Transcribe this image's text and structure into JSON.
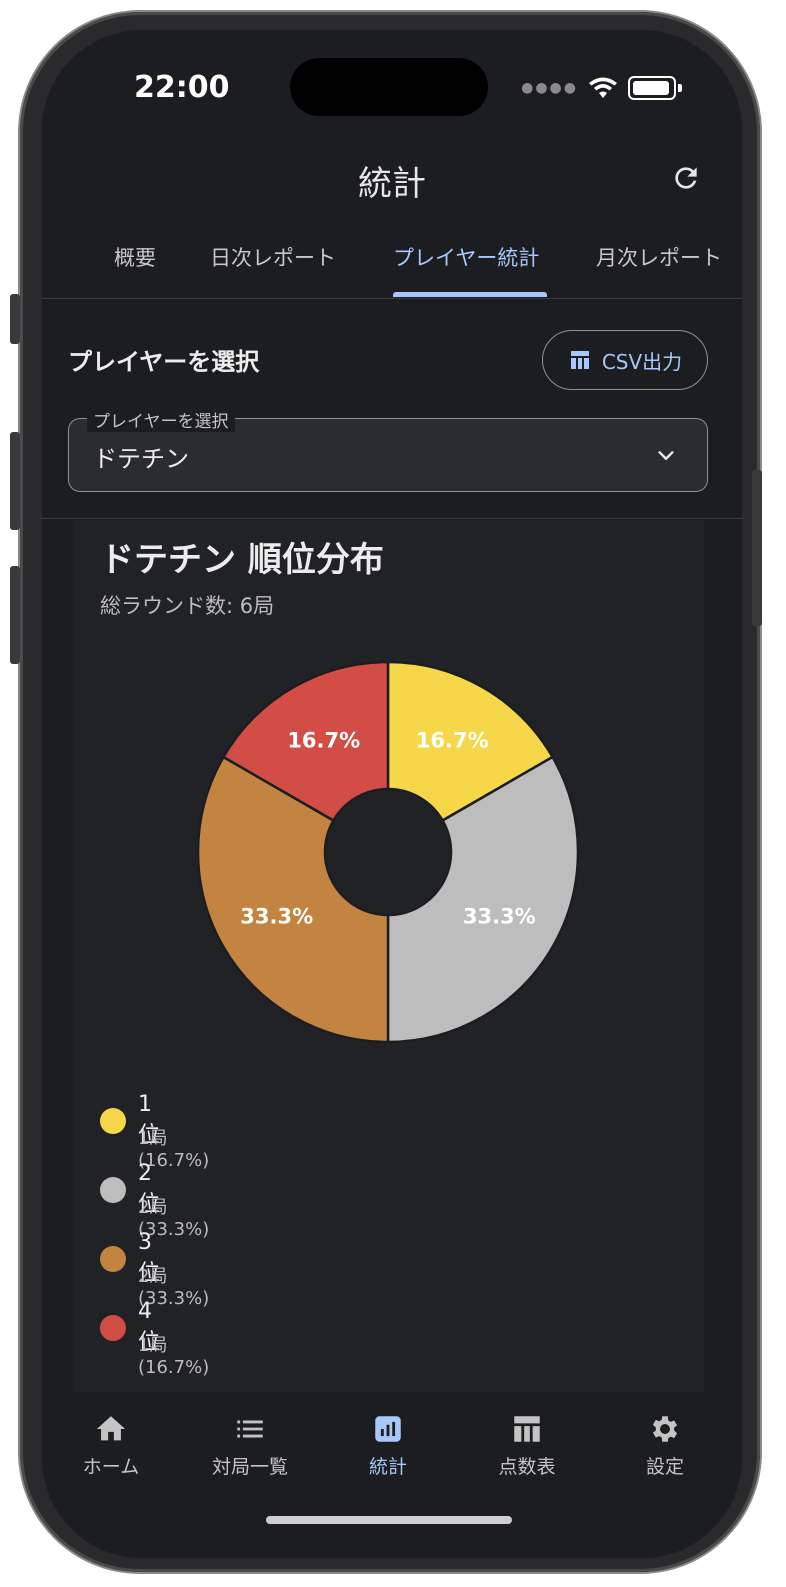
{
  "status_bar": {
    "time": "22:00"
  },
  "header": {
    "title": "統計",
    "refresh_icon": "refresh-icon"
  },
  "tabs": [
    {
      "label": "概要",
      "active": false
    },
    {
      "label": "日次レポート",
      "active": false
    },
    {
      "label": "プレイヤー統計",
      "active": true
    },
    {
      "label": "月次レポート",
      "active": false
    }
  ],
  "player_section": {
    "label": "プレイヤーを選択",
    "csv_button": "CSV出力",
    "select": {
      "legend": "プレイヤーを選択",
      "value": "ドテチン"
    }
  },
  "card": {
    "title": "ドテチン 順位分布",
    "subtitle": "総ラウンド数: 6局"
  },
  "chart_data": {
    "type": "pie",
    "donut": true,
    "categories": [
      "1位",
      "2位",
      "3位",
      "4位"
    ],
    "values": [
      1,
      2,
      2,
      1
    ],
    "percent_labels": [
      "16.7%",
      "33.3%",
      "33.3%",
      "16.7%"
    ],
    "colors": [
      "#f6d74a",
      "#bdbdbd",
      "#c28440",
      "#d24d45"
    ],
    "legend": [
      {
        "name": "1位",
        "detail": "1局 (16.7%)"
      },
      {
        "name": "2位",
        "detail": "2局 (33.3%)"
      },
      {
        "name": "3位",
        "detail": "2局 (33.3%)"
      },
      {
        "name": "4位",
        "detail": "1局 (16.7%)"
      }
    ]
  },
  "bottom_nav": [
    {
      "label": "ホーム",
      "icon": "home-icon",
      "active": false
    },
    {
      "label": "対局一覧",
      "icon": "list-icon",
      "active": false
    },
    {
      "label": "統計",
      "icon": "chart-icon",
      "active": true
    },
    {
      "label": "点数表",
      "icon": "table-icon",
      "active": false
    },
    {
      "label": "設定",
      "icon": "gear-icon",
      "active": false
    }
  ],
  "colors": {
    "accent": "#a8c7fa",
    "background": "#1c1d20"
  }
}
